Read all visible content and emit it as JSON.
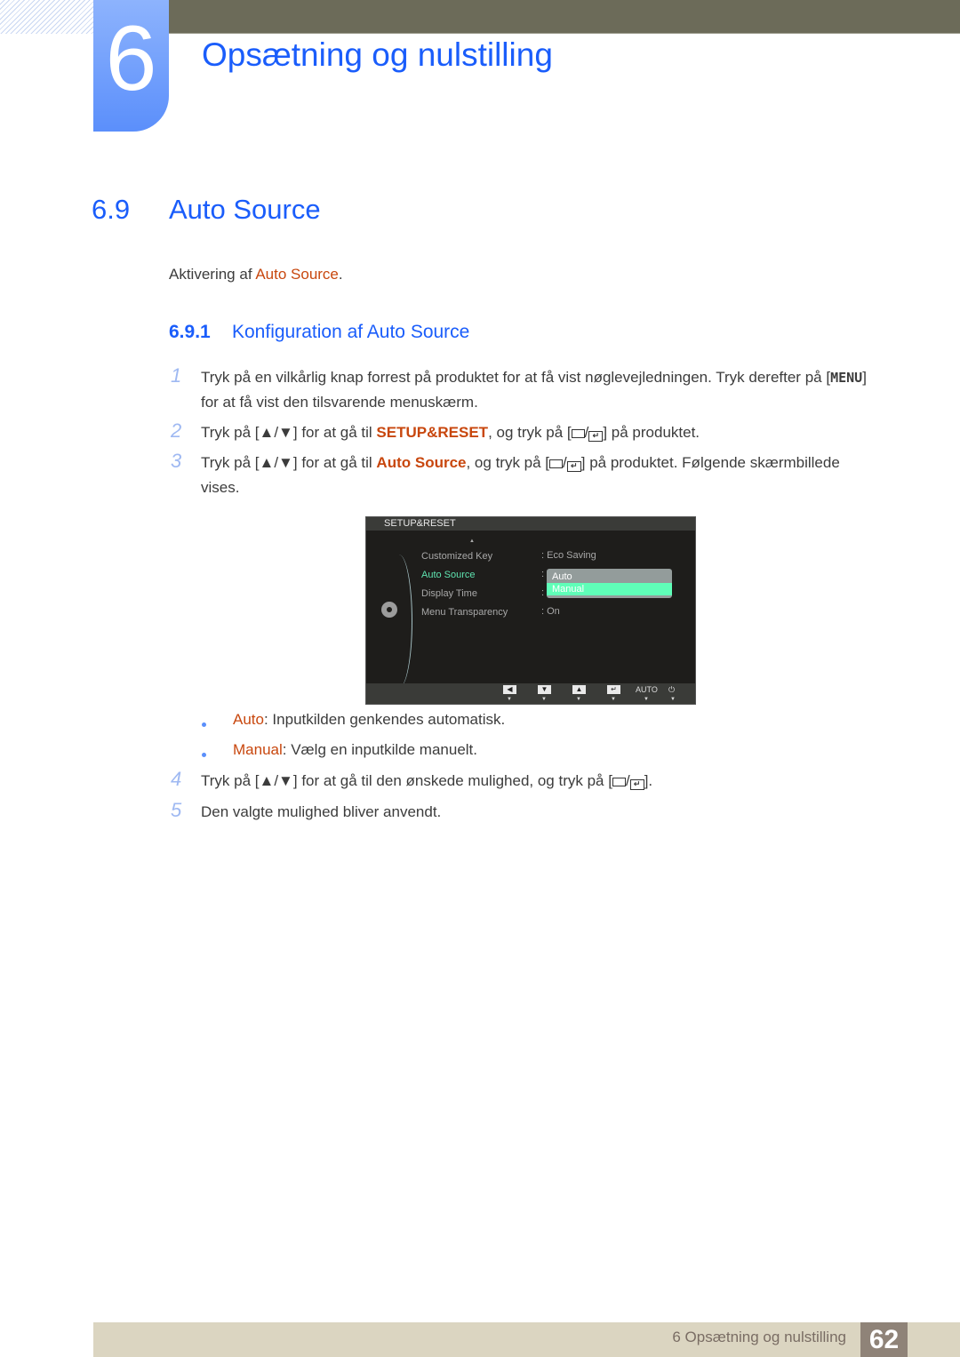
{
  "chapter": {
    "number": "6",
    "title": "Opsætning og nulstilling"
  },
  "section": {
    "number": "6.9",
    "title": "Auto Source",
    "intro_prefix": "Aktivering af ",
    "intro_highlight": "Auto Source",
    "intro_suffix": "."
  },
  "subsection": {
    "number": "6.9.1",
    "title": "Konfiguration af Auto Source"
  },
  "steps": [
    {
      "num": "1",
      "line1": "Tryk på en vilkårlig knap forrest på produktet for at få vist nøglevejledningen. Tryk derefter på [",
      "key": "MENU",
      "line1_end": "]",
      "line2": "for at få vist den tilsvarende menuskærm."
    },
    {
      "num": "2",
      "pre": "Tryk på [▲/▼] for at gå til ",
      "highlight": "SETUP&RESET",
      "mid": ", og tryk på [",
      "post": "] på produktet."
    },
    {
      "num": "3",
      "pre": "Tryk på [▲/▼] for at gå til ",
      "highlight": "Auto Source",
      "mid": ", og tryk på [",
      "post": "] på produktet. Følgende skærmbillede",
      "line2": "vises."
    },
    {
      "num": "4",
      "pre": "Tryk på [▲/▼] for at gå til den ønskede mulighed, og tryk på [",
      "post": "]."
    },
    {
      "num": "5",
      "text": "Den valgte mulighed bliver anvendt."
    }
  ],
  "bullets": [
    {
      "term": "Auto",
      "desc": ": Inputkilden genkendes automatisk."
    },
    {
      "term": "Manual",
      "desc": ": Vælg en inputkilde manuelt."
    }
  ],
  "osd": {
    "header": "SETUP&RESET",
    "items": [
      {
        "label": "Customized Key",
        "value": ": Eco Saving"
      },
      {
        "label": "Auto Source",
        "value": ":"
      },
      {
        "label": "Display Time",
        "value": ":"
      },
      {
        "label": "Menu Transparency",
        "value": ": On"
      }
    ],
    "dropdown": {
      "options": [
        "Auto",
        "Manual"
      ],
      "selected": "Manual"
    },
    "buttons": {
      "left": "◀",
      "down": "▼",
      "up": "▲",
      "enter": "↵",
      "auto": "AUTO",
      "power": "⏻"
    }
  },
  "footer": {
    "chapter_label": "6 Opsætning og nulstilling",
    "page": "62"
  }
}
